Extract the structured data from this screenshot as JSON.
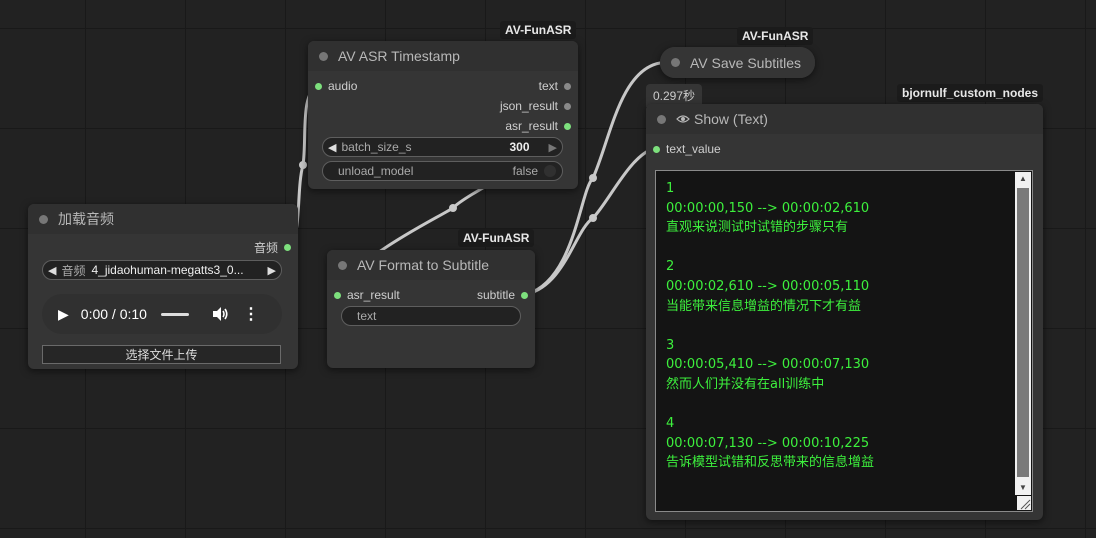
{
  "nodes": {
    "load_audio": {
      "title": "加载音频",
      "output_label": "音频",
      "audio_widget_label": "音频",
      "audio_file": "4_jidaohuman-megatts3_0...",
      "player_time": "0:00 / 0:10",
      "upload_button": "选择文件上传"
    },
    "asr_timestamp": {
      "badge": "AV-FunASR",
      "title": "AV ASR Timestamp",
      "input_audio": "audio",
      "output_text": "text",
      "output_json": "json_result",
      "output_asr": "asr_result",
      "batch_label": "batch_size_s",
      "batch_value": "300",
      "unload_label": "unload_model",
      "unload_value": "false"
    },
    "format_subtitle": {
      "badge": "AV-FunASR",
      "title": "AV Format to Subtitle",
      "input": "asr_result",
      "output": "subtitle",
      "text_widget": "text"
    },
    "save_subtitles": {
      "badge": "AV-FunASR",
      "title": "AV Save Subtitles"
    },
    "show_text": {
      "badge": "bjornulf_custom_nodes",
      "exec_time": "0.297秒",
      "title": "Show (Text)",
      "input": "text_value",
      "content": "1\n00:00:00,150 --> 00:00:02,610\n直观来说测试时试错的步骤只有\n\n2\n00:00:02,610 --> 00:00:05,110\n当能带来信息增益的情况下才有益\n\n3\n00:00:05,410 --> 00:00:07,130\n然而人们并没有在all训练中\n\n4\n00:00:07,130 --> 00:00:10,225\n告诉模型试错和反思带来的信息增益"
    }
  },
  "icons": [
    "eye-icon",
    "play-icon",
    "volume-icon",
    "more-vertical-icon"
  ],
  "colors": {
    "connected_slot": "#7de07d",
    "link": "#c8c8c8",
    "output_text": "#3df03d",
    "canvas": "#222222"
  }
}
